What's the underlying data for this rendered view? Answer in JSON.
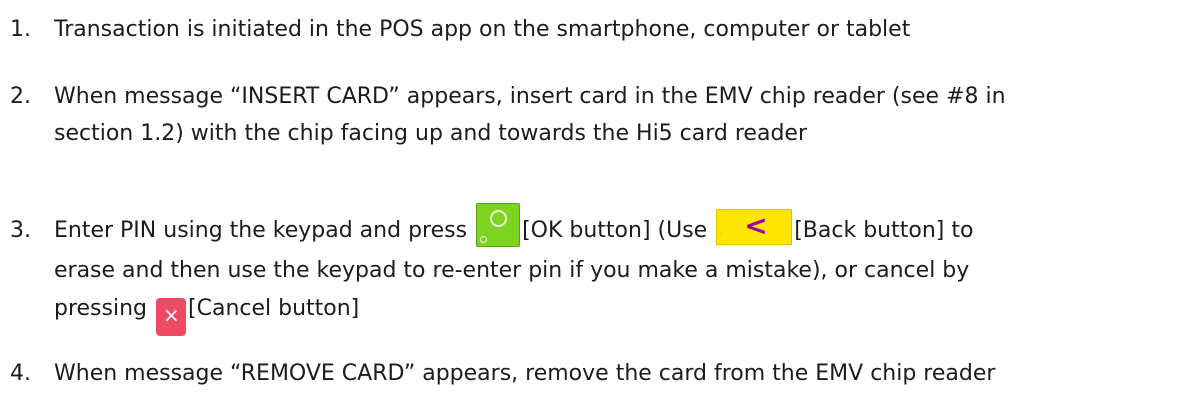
{
  "steps": [
    {
      "number": "1.",
      "text": "Transaction is initiated in the POS app on the smartphone, computer or tablet"
    },
    {
      "number": "2.",
      "line1": "When message “INSERT CARD” appears, insert card in the EMV chip reader (see #8 in",
      "line2": "section 1.2)  with the chip facing up and towards the Hi5 card reader"
    },
    {
      "number": "3.",
      "line1_a": "Enter PIN using the keypad and press",
      "line1_b": "[OK button] (Use",
      "line1_c": "[Back button] to",
      "line2": "erase and then use the keypad to re-enter pin if you make a mistake), or cancel by",
      "line3_a": "pressing",
      "line3_b": "[Cancel button]"
    },
    {
      "number": "4.",
      "text": "When message “REMOVE CARD” appears, remove the card from the EMV chip reader"
    }
  ],
  "icons": {
    "ok": "ok-button-icon",
    "back": "back-button-icon",
    "cancel": "cancel-button-icon"
  },
  "colors": {
    "ok": "#7ed321",
    "back": "#ffe600",
    "cancel": "#ef4a64"
  }
}
